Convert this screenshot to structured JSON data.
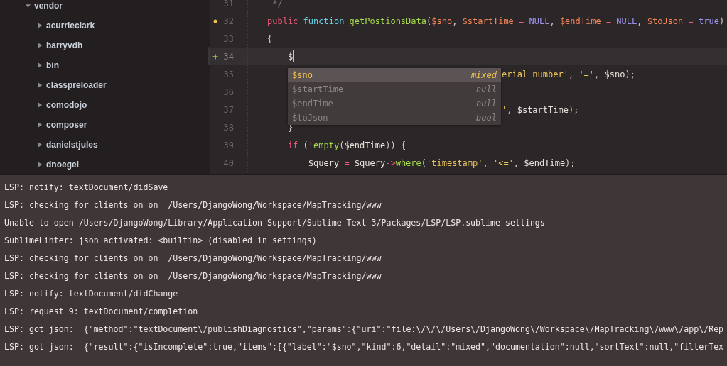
{
  "sidebar": {
    "items": [
      {
        "label": "vendor",
        "expanded": true,
        "children": [
          {
            "label": "acurrieclark",
            "expanded": false
          },
          {
            "label": "barryvdh",
            "expanded": false
          },
          {
            "label": "bin",
            "expanded": false
          },
          {
            "label": "classpreloader",
            "expanded": false
          },
          {
            "label": "comodojo",
            "expanded": false
          },
          {
            "label": "composer",
            "expanded": false
          },
          {
            "label": "danielstjules",
            "expanded": false
          },
          {
            "label": "dnoegel",
            "expanded": false
          }
        ]
      }
    ]
  },
  "editor": {
    "lines": [
      {
        "number": "31",
        "tokens": [
          {
            "text": " */",
            "kind": "comment"
          }
        ]
      },
      {
        "number": "32",
        "modified": true,
        "tokens": [
          {
            "text": "public ",
            "kind": "storage"
          },
          {
            "text": "function ",
            "kind": "type"
          },
          {
            "text": "getPostionsData",
            "kind": "func"
          },
          {
            "text": "(",
            "kind": "plain"
          },
          {
            "text": "$sno",
            "kind": "param"
          },
          {
            "text": ", ",
            "kind": "plain"
          },
          {
            "text": "$startTime",
            "kind": "param"
          },
          {
            "text": " = ",
            "kind": "op"
          },
          {
            "text": "NULL",
            "kind": "const"
          },
          {
            "text": ", ",
            "kind": "plain"
          },
          {
            "text": "$endTime",
            "kind": "param"
          },
          {
            "text": " = ",
            "kind": "op"
          },
          {
            "text": "NULL",
            "kind": "const"
          },
          {
            "text": ", ",
            "kind": "plain"
          },
          {
            "text": "$toJson",
            "kind": "param"
          },
          {
            "text": " = ",
            "kind": "op"
          },
          {
            "text": "true",
            "kind": "const"
          },
          {
            "text": ")",
            "kind": "plain"
          }
        ]
      },
      {
        "number": "33",
        "tokens": [
          {
            "text": "{",
            "kind": "plain",
            "underline": true
          }
        ]
      },
      {
        "number": "34",
        "added": true,
        "current": true,
        "cursor": true,
        "tokens": [
          {
            "text": "    $",
            "kind": "var"
          }
        ]
      },
      {
        "number": "35",
        "after_popup": true,
        "tokens": [
          {
            "text": "erial_number'",
            "kind": "str"
          },
          {
            "text": ", ",
            "kind": "plain"
          },
          {
            "text": "'='",
            "kind": "str"
          },
          {
            "text": ", ",
            "kind": "plain"
          },
          {
            "text": "$sno",
            "kind": "var"
          },
          {
            "text": ");",
            "kind": "plain"
          }
        ]
      },
      {
        "number": "36"
      },
      {
        "number": "37",
        "after_popup": true,
        "tokens": [
          {
            "text": "'",
            "kind": "str"
          },
          {
            "text": ", ",
            "kind": "plain"
          },
          {
            "text": "$startTime",
            "kind": "var"
          },
          {
            "text": ");",
            "kind": "plain"
          }
        ]
      },
      {
        "number": "38",
        "tokens": [
          {
            "text": "    }",
            "kind": "plain"
          }
        ]
      },
      {
        "number": "39",
        "tokens": [
          {
            "text": "    if",
            "kind": "storage"
          },
          {
            "text": " (",
            "kind": "plain"
          },
          {
            "text": "!",
            "kind": "op"
          },
          {
            "text": "empty",
            "kind": "func"
          },
          {
            "text": "(",
            "kind": "plain"
          },
          {
            "text": "$endTime",
            "kind": "var"
          },
          {
            "text": ")) {",
            "kind": "plain"
          }
        ]
      },
      {
        "number": "40",
        "tokens": [
          {
            "text": "        $query",
            "kind": "var"
          },
          {
            "text": " = ",
            "kind": "op"
          },
          {
            "text": "$query",
            "kind": "var"
          },
          {
            "text": "->",
            "kind": "op"
          },
          {
            "text": "where",
            "kind": "func"
          },
          {
            "text": "(",
            "kind": "plain"
          },
          {
            "text": "'timestamp'",
            "kind": "str"
          },
          {
            "text": ", ",
            "kind": "plain"
          },
          {
            "text": "'<='",
            "kind": "str"
          },
          {
            "text": ", ",
            "kind": "plain"
          },
          {
            "text": "$endTime",
            "kind": "var"
          },
          {
            "text": ");",
            "kind": "plain"
          }
        ]
      }
    ],
    "completions": [
      {
        "label": "$sno",
        "detail": "mixed",
        "selected": true
      },
      {
        "label": "$startTime",
        "detail": "null",
        "selected": false
      },
      {
        "label": "$endTime",
        "detail": "null",
        "selected": false
      },
      {
        "label": "$toJson",
        "detail": "bool",
        "selected": false
      }
    ]
  },
  "console": {
    "lines": [
      "LSP: notify: textDocument/didSave",
      "LSP: checking for clients on on  /Users/DjangoWong/Workspace/MapTracking/www",
      "Unable to open /Users/DjangoWong/Library/Application Support/Sublime Text 3/Packages/LSP/LSP.sublime-settings",
      "SublimeLinter: json activated: <builtin> (disabled in settings)",
      "LSP: checking for clients on on  /Users/DjangoWong/Workspace/MapTracking/www",
      "LSP: checking for clients on on  /Users/DjangoWong/Workspace/MapTracking/www",
      "LSP: notify: textDocument/didChange",
      "LSP: request 9: textDocument/completion",
      "LSP: got json:  {\"method\":\"textDocument\\/publishDiagnostics\",\"params\":{\"uri\":\"file:\\/\\/\\/Users\\/DjangoWong\\/Workspace\\/MapTracking\\/www\\/app\\/Rep",
      "LSP: got json:  {\"result\":{\"isIncomplete\":true,\"items\":[{\"label\":\"$sno\",\"kind\":6,\"detail\":\"mixed\",\"documentation\":null,\"sortText\":null,\"filterTex"
    ]
  }
}
